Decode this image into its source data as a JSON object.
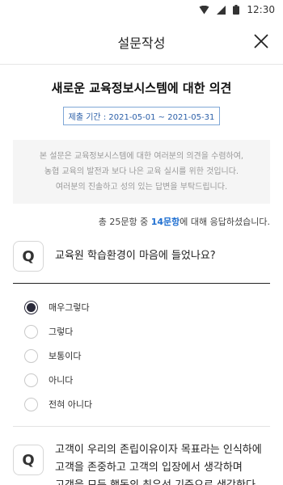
{
  "status_bar": {
    "time": "12:30",
    "icons": [
      "wifi-icon",
      "signal-icon",
      "battery-icon"
    ]
  },
  "header": {
    "title": "설문작성",
    "close_icon": "close-icon"
  },
  "survey": {
    "title": "새로운 교육정보시스템에 대한 의견",
    "period_label": "제출 기간 :",
    "period_value": "2021-05-01 ~ 2021-05-31",
    "intro_lines": [
      "본 설문은 교육정보시스템에 대한 여러분의 의견을 수렴하여,",
      "농협 교육의 발전과 보다 나은 교육 실시를 위한 것입니다.",
      "여러분의 진솔하고 성의 있는 답변을 부탁드립니다."
    ]
  },
  "progress": {
    "prefix": "총 25문항 중 ",
    "answered": "14문항",
    "suffix": "에 대해 응답하셨습니다."
  },
  "questions": [
    {
      "badge": "Q",
      "text": "교육원 학습환경이 마음에 들었나요?",
      "options": [
        "매우그렇다",
        "그렇다",
        "보통이다",
        "아니다",
        "전혀 아니다"
      ],
      "selected_index": 0
    },
    {
      "badge": "Q",
      "lines": [
        "고객이 우리의 존립이유이자 목표라는 인식하에",
        "고객을 존중하고 고객의 입장에서 생각하며",
        "고객을 모든 행동의 최우선 기준으로 생각한다."
      ]
    }
  ],
  "colors": {
    "accent_blue": "#1f6fd1",
    "period_blue": "#2b5fa8",
    "radio_selected": "#2a2a3a"
  }
}
